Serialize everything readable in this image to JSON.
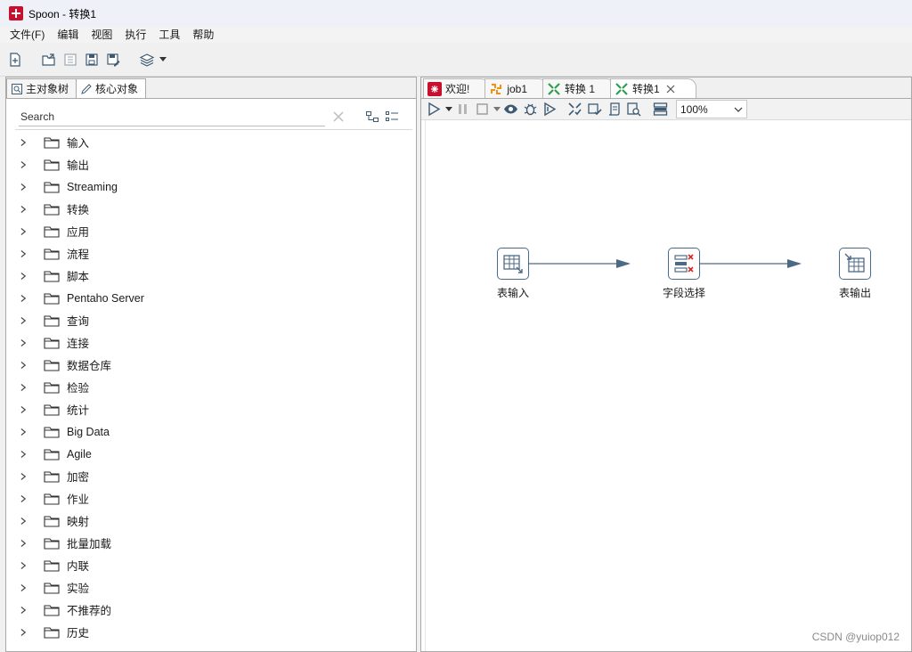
{
  "window": {
    "title": "Spoon - 转换1"
  },
  "menu": [
    "文件(F)",
    "编辑",
    "视图",
    "执行",
    "工具",
    "帮助"
  ],
  "left_tabs": [
    {
      "label": "主对象树",
      "icon": "tree-view-icon",
      "active": false
    },
    {
      "label": "核心对象",
      "icon": "pencil-icon",
      "active": true
    }
  ],
  "search": {
    "placeholder": "Search",
    "value": ""
  },
  "tree_items": [
    "输入",
    "输出",
    "Streaming",
    "转换",
    "应用",
    "流程",
    "脚本",
    "Pentaho Server",
    "查询",
    "连接",
    "数据仓库",
    "检验",
    "统计",
    "Big Data",
    "Agile",
    "加密",
    "作业",
    "映射",
    "批量加载",
    "内联",
    "实验",
    "不推荐的",
    "历史"
  ],
  "editor_tabs": [
    {
      "label": "欢迎!",
      "icon": "spoon-logo-icon",
      "active": false,
      "closable": false
    },
    {
      "label": "job1",
      "icon": "job-icon",
      "active": false,
      "closable": false
    },
    {
      "label": "转换 1",
      "icon": "transformation-icon",
      "active": false,
      "closable": false
    },
    {
      "label": "转换1",
      "icon": "transformation-icon",
      "active": true,
      "closable": true
    }
  ],
  "zoom": {
    "value": "100%"
  },
  "steps": [
    {
      "id": "table-input",
      "label": "表输入",
      "icon": "table-input-icon"
    },
    {
      "id": "select-values",
      "label": "字段选择",
      "icon": "select-values-icon"
    },
    {
      "id": "table-output",
      "label": "表输出",
      "icon": "table-output-icon"
    }
  ],
  "hops": [
    {
      "from": "表输入",
      "to": "字段选择"
    },
    {
      "from": "字段选择",
      "to": "表输出"
    }
  ],
  "watermark": "CSDN @yuiop012",
  "colors": {
    "accent": "#4d6a85",
    "logo_red": "#c8102e",
    "job_orange": "#f29111",
    "trans_green": "#2e9e4f"
  }
}
